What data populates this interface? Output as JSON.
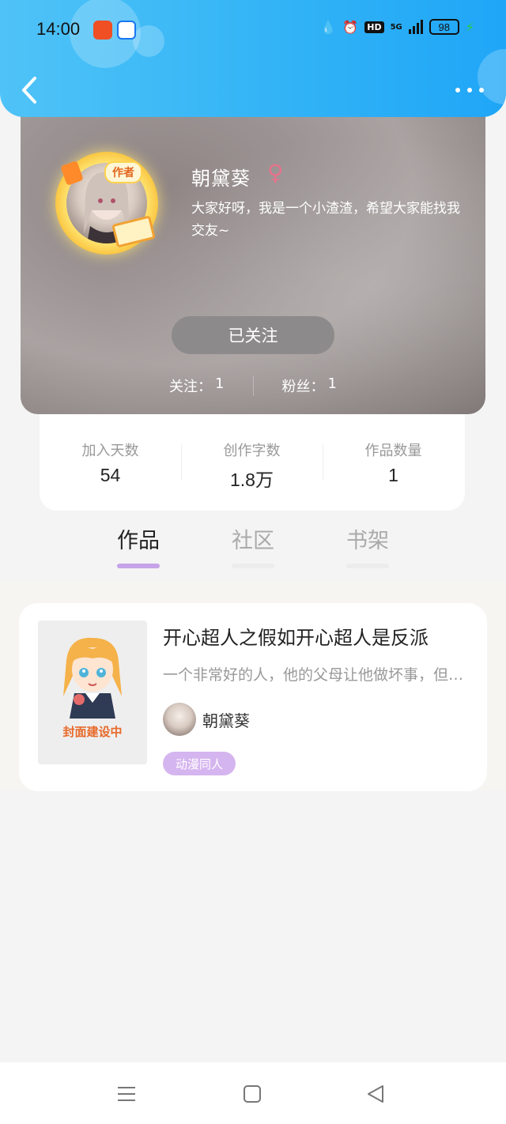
{
  "status_bar": {
    "time": "14:00",
    "hd_label": "HD",
    "network": "5G",
    "battery": "98"
  },
  "header": {
    "back_icon": "chevron-left-icon",
    "more_icon": "more-dots-icon"
  },
  "profile": {
    "badge": "作者",
    "username": "朝黛葵",
    "gender_symbol": "♀",
    "bio": "大家好呀，我是一个小渣渣，希望大家能找我交友~",
    "follow_button_label": "已关注",
    "following_label": "关注：",
    "following_count": "1",
    "followers_label": "粉丝：",
    "followers_count": "1"
  },
  "stats": [
    {
      "label": "加入天数",
      "value": "54"
    },
    {
      "label": "创作字数",
      "value": "1.8万"
    },
    {
      "label": "作品数量",
      "value": "1"
    }
  ],
  "tabs": [
    {
      "label": "作品",
      "active": true
    },
    {
      "label": "社区",
      "active": false
    },
    {
      "label": "书架",
      "active": false
    }
  ],
  "works": [
    {
      "cover_text": "封面建设中",
      "title": "开心超人之假如开心超人是反派",
      "description": "一个非常好的人，他的父母让他做坏事，但是他却不想做坏事",
      "author": "朝黛葵",
      "tag": "动漫同人"
    }
  ],
  "colors": {
    "header_blue": "#35b5f6",
    "tab_active_underline": "#c6a3e8",
    "genre_tag": "#d5b5ef",
    "gender_pink": "#e6738c"
  }
}
